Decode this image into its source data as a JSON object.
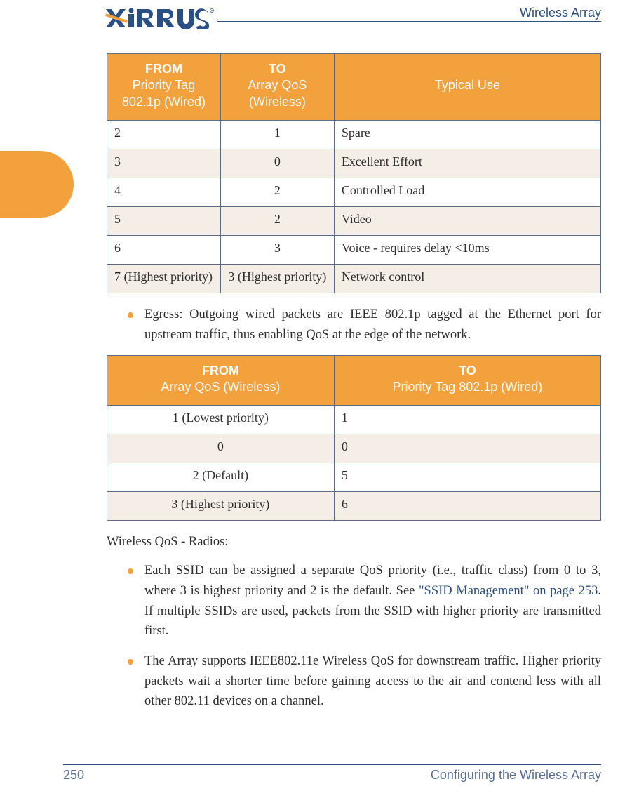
{
  "header": {
    "title": "Wireless Array",
    "logo_word": "XIRRUS"
  },
  "table1": {
    "headers": {
      "col1_bold": "FROM",
      "col1_sub": "Priority Tag 802.1p (Wired)",
      "col2_bold": "TO",
      "col2_sub": "Array QoS (Wireless)",
      "col3": "Typical Use"
    },
    "rows": [
      {
        "from": "2",
        "to": "1",
        "use": "Spare",
        "shade": false
      },
      {
        "from": "3",
        "to": "0",
        "use": "Excellent Effort",
        "shade": true
      },
      {
        "from": "4",
        "to": "2",
        "use": "Controlled Load",
        "shade": false
      },
      {
        "from": "5",
        "to": "2",
        "use": "Video",
        "shade": true
      },
      {
        "from": "6",
        "to": "3",
        "use": "Voice - requires delay <10ms",
        "shade": false
      },
      {
        "from": "7 (Highest priority)",
        "to": "3 (Highest priority)",
        "use": "Network control",
        "shade": true
      }
    ]
  },
  "bullets_top": {
    "b1": "Egress: Outgoing wired packets are IEEE 802.1p tagged at the Ethernet port for upstream traffic, thus enabling QoS at the edge of the network."
  },
  "table2": {
    "headers": {
      "col1_bold": "FROM",
      "col1_sub": "Array QoS (Wireless)",
      "col2_bold": "TO",
      "col2_sub": "Priority Tag 802.1p (Wired)"
    },
    "rows": [
      {
        "from": "1 (Lowest priority)",
        "to": "1",
        "shade": false
      },
      {
        "from": "0",
        "to": "0",
        "shade": true
      },
      {
        "from": "2 (Default)",
        "to": "5",
        "shade": false
      },
      {
        "from": "3 (Highest priority)",
        "to": "6",
        "shade": true
      }
    ]
  },
  "section_heading": "Wireless QoS - Radios:",
  "bullets_bottom": {
    "b1_pre": "Each SSID can be assigned a separate QoS priority (i.e., traffic class) from 0 to 3, where 3 is highest priority and 2 is the default. See ",
    "b1_link": "\"SSID Management\" on page 253",
    "b1_post": ". If multiple SSIDs are used, packets from the SSID with higher priority are transmitted first.",
    "b2": "The Array supports IEEE802.11e Wireless QoS for downstream traffic. Higher priority packets wait a shorter time before gaining access to the air and contend less with all other 802.11 devices on a channel."
  },
  "footer": {
    "page": "250",
    "chapter": "Configuring the Wireless Array"
  }
}
